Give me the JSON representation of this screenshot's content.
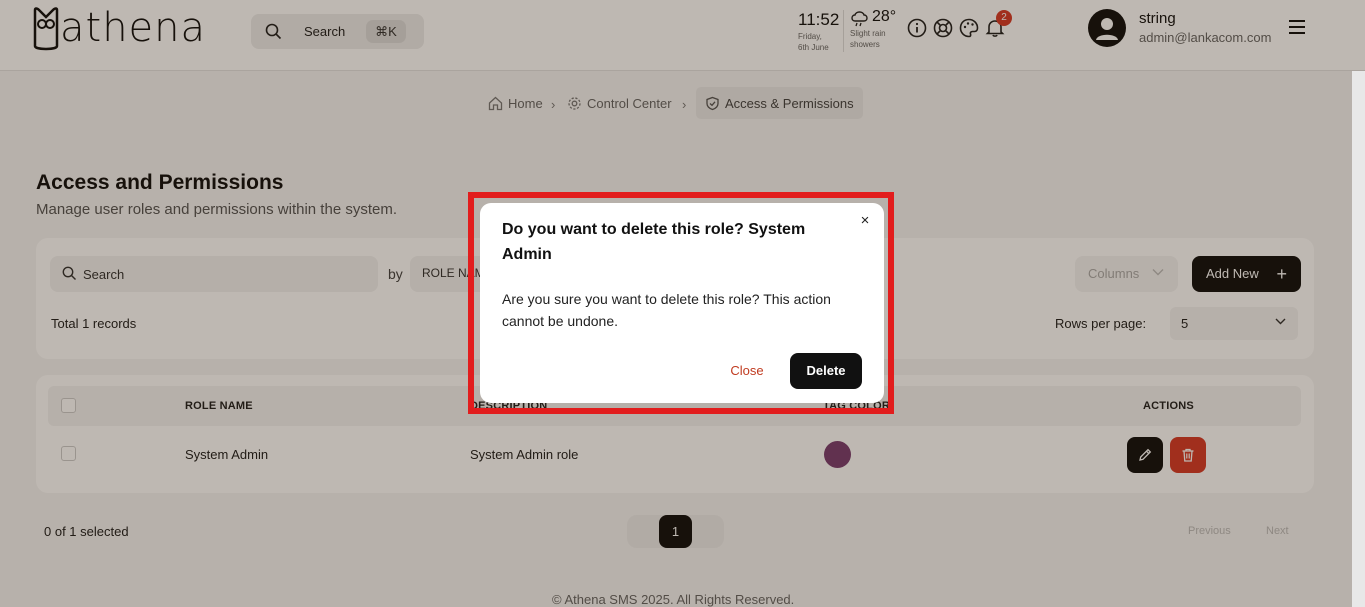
{
  "app": {
    "logo_text": "athena"
  },
  "header": {
    "search_label": "Search",
    "search_shortcut": "⌘K",
    "time": "11:52",
    "date_line1": "Friday,",
    "date_line2": "6th June",
    "temperature": "28°",
    "weather_desc_line1": "Slight rain",
    "weather_desc_line2": "showers",
    "notification_count": "2",
    "user_name": "string",
    "user_email": "admin@lankacom.com"
  },
  "breadcrumb": {
    "items": [
      {
        "label": "Home",
        "icon": "home-icon"
      },
      {
        "label": "Control Center",
        "icon": "gear-icon"
      },
      {
        "label": "Access & Permissions",
        "icon": "shield-icon"
      }
    ]
  },
  "page": {
    "title": "Access and Permissions",
    "subtitle": "Manage user roles and permissions within the system."
  },
  "toolbar": {
    "search_placeholder": "Search",
    "by_label": "by",
    "by_value": "ROLE NAME",
    "columns_label": "Columns",
    "add_new_label": "Add New",
    "total_records": "Total 1 records",
    "rows_per_page_label": "Rows per page:",
    "rows_per_page_value": "5"
  },
  "table": {
    "headers": [
      "ROLE NAME",
      "DESCRIPTION",
      "TAG COLOR",
      "ACTIONS"
    ],
    "rows": [
      {
        "role_name": "System Admin",
        "description": "System Admin role",
        "tag_color": "#7a3e72"
      }
    ]
  },
  "footer": {
    "selected_text": "0 of 1 selected",
    "current_page": "1",
    "previous_label": "Previous",
    "next_label": "Next",
    "copyright": "© Athena SMS 2025. All Rights Reserved."
  },
  "modal": {
    "title": "Do you want to delete this role? System Admin",
    "close_x": "×",
    "body": "Are you sure you want to delete this role? This action cannot be undone.",
    "close_label": "Close",
    "delete_label": "Delete"
  },
  "colors": {
    "accent_dark": "#111111",
    "danger": "#d63b2a",
    "highlight": "#e21d1d"
  }
}
